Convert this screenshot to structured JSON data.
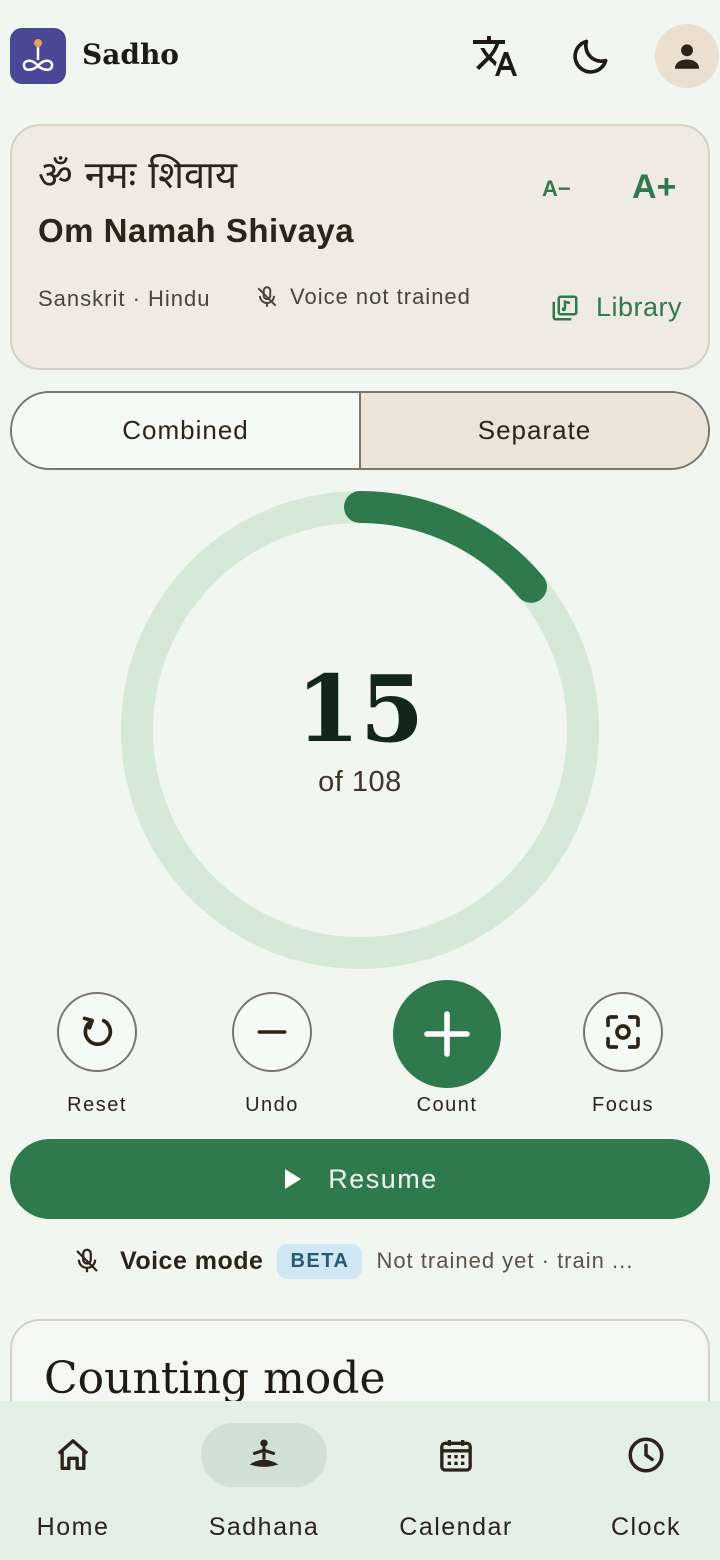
{
  "header": {
    "app_title": "Sadho",
    "icons": {
      "logo": "lotus-figure-icon",
      "translate": "translate-icon",
      "theme": "moon-icon",
      "account": "person-icon"
    }
  },
  "mantra": {
    "devanagari": "ॐ नमः शिवाय",
    "latin": "Om Namah Shivaya",
    "font_decrease": "A−",
    "font_increase": "A+",
    "meta": "Sanskrit · Hindu",
    "voice_status": "Voice not trained",
    "library_label": "Library"
  },
  "mode_toggle": {
    "combined": "Combined",
    "separate": "Separate",
    "selected": "Separate"
  },
  "counter": {
    "value": "15",
    "total_label": "of 108",
    "progress_fraction": 0.139
  },
  "actions": {
    "reset": "Reset",
    "undo": "Undo",
    "count": "Count",
    "focus": "Focus"
  },
  "resume": {
    "label": "Resume"
  },
  "voice_mode": {
    "label": "Voice mode",
    "badge": "BETA",
    "status": "Not trained yet · train ..."
  },
  "counting_mode": {
    "title": "Counting mode"
  },
  "bottom_nav": {
    "items": [
      {
        "label": "Home",
        "icon": "home-icon"
      },
      {
        "label": "Sadhana",
        "icon": "meditation-icon"
      },
      {
        "label": "Calendar",
        "icon": "calendar-icon"
      },
      {
        "label": "Clock",
        "icon": "clock-icon"
      }
    ],
    "active": "Sadhana"
  },
  "colors": {
    "accent": "#2e7a4d",
    "ring_track": "#d6e8d8",
    "logo_bg": "#4a4796"
  }
}
